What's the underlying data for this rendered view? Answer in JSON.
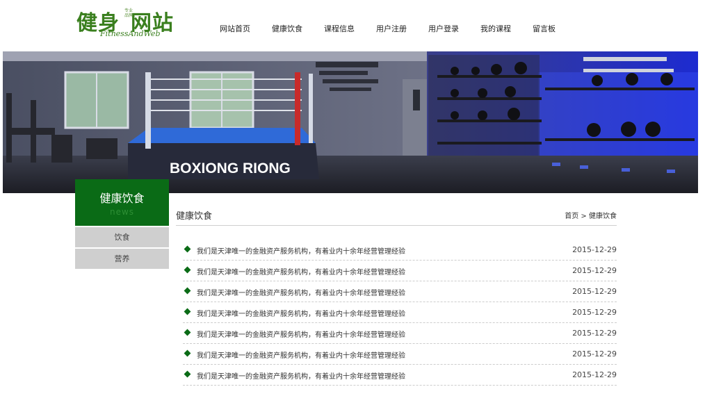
{
  "logo": {
    "main_left": "健身",
    "main_right": "网站",
    "subtitle": "FitnessAndWeb",
    "badge": "专业品牌"
  },
  "nav": {
    "items": [
      "网站首页",
      "健康饮食",
      "课程信息",
      "用户注册",
      "用户登录",
      "我的课程",
      "留言板"
    ]
  },
  "banner": {
    "caption": "BOXIONG RIONG"
  },
  "sidebar": {
    "title": "健康饮食",
    "subtitle": "news",
    "items": [
      "饮食",
      "营养"
    ]
  },
  "content": {
    "title": "健康饮食",
    "breadcrumb": {
      "home": "首页",
      "separator": ">",
      "current": "健康饮食"
    },
    "rows": [
      {
        "title": "我们是天津唯一的金融资产服务机构，有着业内十余年经营管理经验",
        "date": "2015-12-29"
      },
      {
        "title": "我们是天津唯一的金融资产服务机构，有着业内十余年经营管理经验",
        "date": "2015-12-29"
      },
      {
        "title": "我们是天津唯一的金融资产服务机构，有着业内十余年经营管理经验",
        "date": "2015-12-29"
      },
      {
        "title": "我们是天津唯一的金融资产服务机构，有着业内十余年经营管理经验",
        "date": "2015-12-29"
      },
      {
        "title": "我们是天津唯一的金融资产服务机构，有着业内十余年经营管理经验",
        "date": "2015-12-29"
      },
      {
        "title": "我们是天津唯一的金融资产服务机构，有着业内十余年经营管理经验",
        "date": "2015-12-29"
      },
      {
        "title": "我们是天津唯一的金融资产服务机构，有着业内十余年经营管理经验",
        "date": "2015-12-29"
      }
    ]
  },
  "colors": {
    "brand_green": "#0a6b16",
    "logo_green": "#3a7f1e",
    "sidebar_gray": "#cfcfcf"
  }
}
